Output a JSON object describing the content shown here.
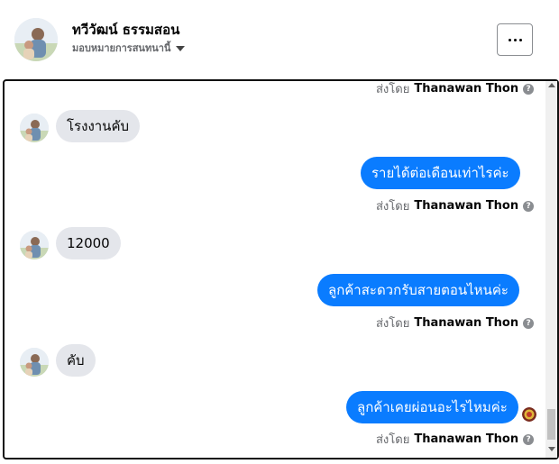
{
  "header": {
    "name": "ทวีวัฒน์ ธรรมสอน",
    "assign": "มอบหมายการสนทนานี้",
    "more_icon": "more-horizontal-icon"
  },
  "messages": [
    {
      "sentby_prefix": "ส่งโดย",
      "sentby_name": "Thanawan Thon"
    },
    {
      "text": "โรงงานคับ"
    },
    {
      "text": "รายได้ต่อเดือนเท่าไรค่ะ",
      "sentby_prefix": "ส่งโดย",
      "sentby_name": "Thanawan Thon"
    },
    {
      "text": "12000"
    },
    {
      "text": "ลูกค้าสะดวกรับสายตอนไหนค่ะ",
      "sentby_prefix": "ส่งโดย",
      "sentby_name": "Thanawan Thon"
    },
    {
      "text": "คับ"
    },
    {
      "text": "ลูกค้าเคยผ่อนอะไรไหมค่ะ",
      "sentby_prefix": "ส่งโดย",
      "sentby_name": "Thanawan Thon"
    }
  ],
  "help_glyph": "?",
  "colors": {
    "outgoing_bubble": "#0a7cff",
    "incoming_bubble": "#e4e6eb",
    "meta_text": "#65676b"
  }
}
